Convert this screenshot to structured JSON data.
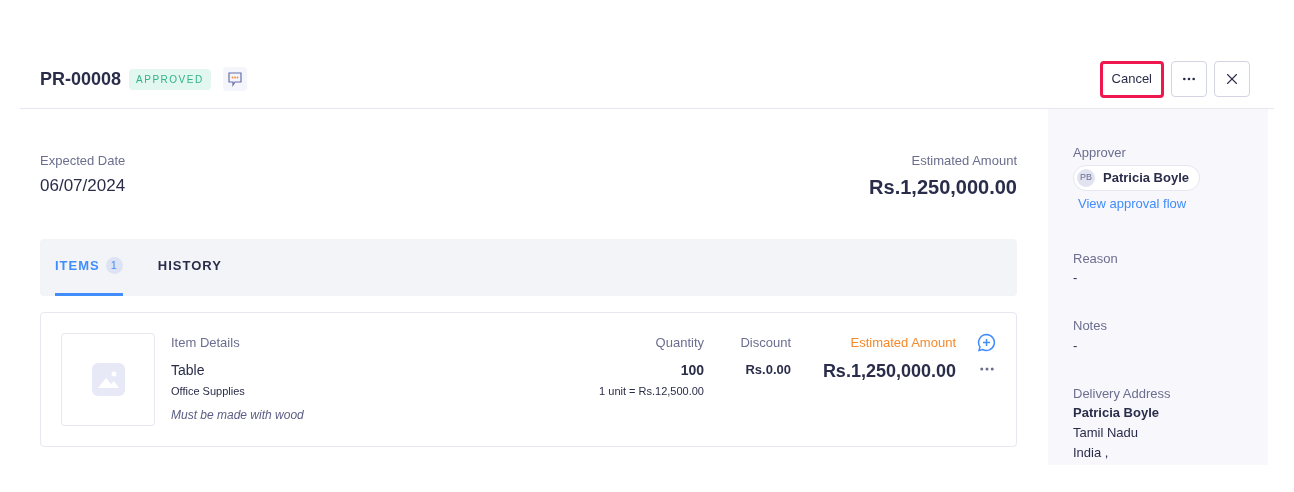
{
  "header": {
    "title": "PR-00008",
    "status": "APPROVED",
    "actions": [
      {
        "kind": "text",
        "label": "Cancel",
        "highlighted": true
      },
      {
        "kind": "more",
        "highlighted": false
      },
      {
        "kind": "close",
        "highlighted": false
      }
    ]
  },
  "summary": {
    "date_label": "Expected Date",
    "date": "06/07/2024",
    "amount_label": "Estimated Amount",
    "amount": "Rs.1,250,000.00"
  },
  "tabs": [
    {
      "label": "ITEMS",
      "count": "1",
      "selected": true
    },
    {
      "label": "HISTORY",
      "selected": false
    }
  ],
  "items_table": {
    "columns": [
      "Item Details",
      "Quantity",
      "Discount",
      "Estimated Amount"
    ],
    "rows": [
      {
        "name": "Table",
        "category": "Office Supplies",
        "note": "Must be made with wood",
        "quantity": "100",
        "unit_price": "1 unit = Rs.12,500.00",
        "discount": "Rs.0.00",
        "amount": "Rs.1,250,000.00"
      }
    ]
  },
  "sidebar": {
    "approver_label": "Approver",
    "approver_initials": "PB",
    "approver": "Patricia Boyle",
    "approval_link": "View approval flow",
    "fields": [
      {
        "label": "Reason",
        "lines": [
          "-"
        ]
      },
      {
        "label": "Notes",
        "lines": [
          "-"
        ]
      },
      {
        "label": "Delivery Address",
        "lines": [
          "Patricia Boyle",
          "Tamil Nadu",
          "India ,"
        ]
      }
    ]
  }
}
